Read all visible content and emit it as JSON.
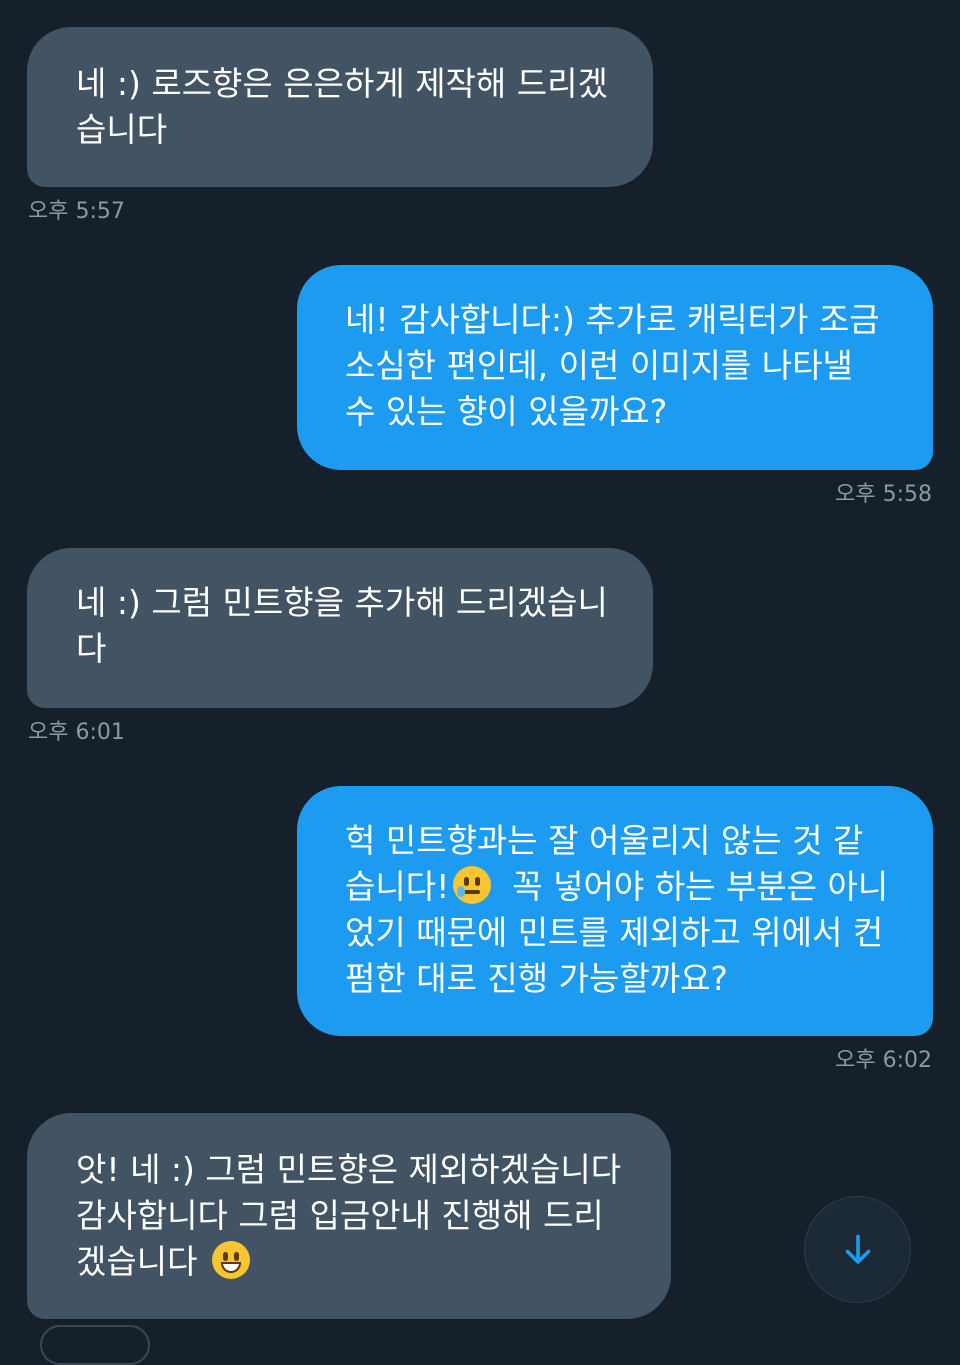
{
  "messages": [
    {
      "direction": "received",
      "lines": [
        "네 :) 로즈향은 은은하게 제작해 드리겠",
        "습니다"
      ],
      "time": "오후 5:57"
    },
    {
      "direction": "sent",
      "lines": [
        "네! 감사합니다:) 추가로 캐릭터가 조금",
        "소심한 편인데, 이런 이미지를 나타낼",
        "수 있는 향이 있을까요?"
      ],
      "time": "오후 5:58"
    },
    {
      "direction": "received",
      "lines": [
        "네 :) 그럼 민트향을 추가해 드리겠습니",
        "다"
      ],
      "time": "오후 6:01"
    },
    {
      "direction": "sent",
      "lines": [
        "헉 민트향과는 잘 어울리지 않는 것 같",
        "습니다!",
        "꼭 넣어야 하는 부분은 아니",
        "었기 때문에 민트를 제외하고 위에서 컨",
        "펌한 대로 진행 가능할까요?"
      ],
      "emoji": "face-holding-back-tears",
      "time": "오후 6:02"
    },
    {
      "direction": "received",
      "lines": [
        "앗! 네 :) 그럼 민트향은 제외하겠습니다",
        "감사합니다 그럼 입금안내 진행해 드리",
        "겠습니다"
      ],
      "emoji": "grinning-face"
    }
  ],
  "scroll_button": {
    "icon": "arrow-down-icon"
  },
  "colors": {
    "background": "#15202b",
    "received_bubble": "#425364",
    "sent_bubble": "#1d9bf0",
    "timestamp": "#8b98a5"
  }
}
